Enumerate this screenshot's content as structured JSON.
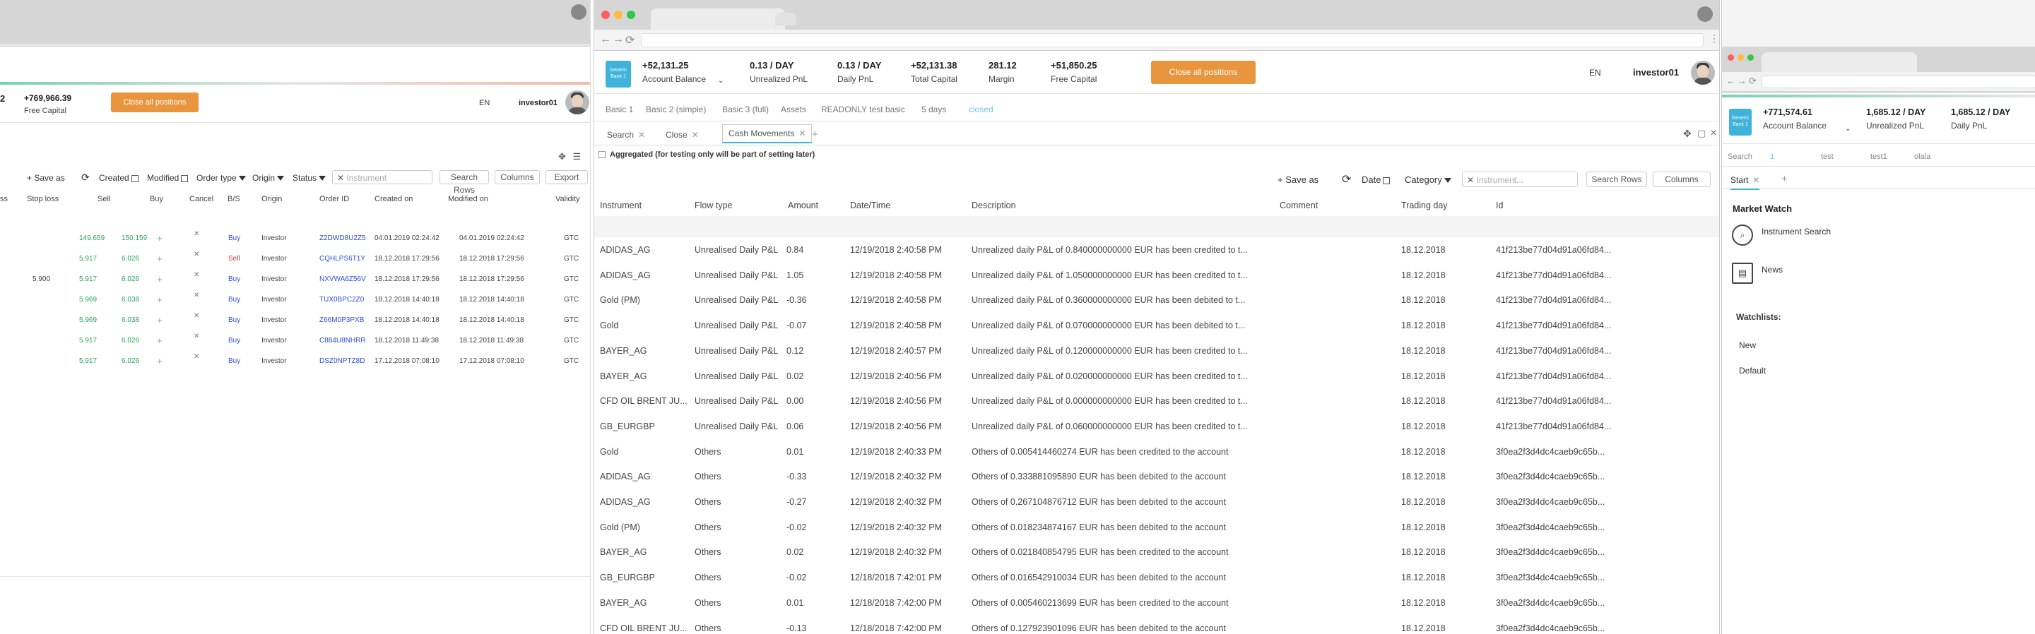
{
  "left_window": {
    "header": {
      "capital_partial": "2",
      "free_capital_value": "+769,966.39",
      "free_capital_label": "Free Capital",
      "close_all_label": "Close all positions",
      "lang": "EN",
      "user": "investor01"
    },
    "toolbar": {
      "save_as": "+ Save as",
      "created": "Created",
      "modified": "Modified",
      "order_type": "Order type",
      "origin": "Origin",
      "status": "Status",
      "search_placeholder": "Instrument",
      "search_rows": "Search Rows",
      "columns": "Columns",
      "export": "Export"
    },
    "columns": [
      "ss",
      "Stop loss",
      "Sell",
      "Buy",
      "Cancel",
      "B/S",
      "Origin",
      "Order ID",
      "Created on",
      "Modified on",
      "Validity"
    ],
    "rows": [
      {
        "stop": "",
        "sell": "149.659",
        "buy": "150.159",
        "bs": "Buy",
        "origin": "Investor",
        "order_id": "Z2DWD8U2Z5",
        "created": "04.01.2019 02:24:42",
        "modified": "04.01.2019 02:24:42",
        "validity": "GTC"
      },
      {
        "stop": "",
        "sell": "5.917",
        "buy": "6.026",
        "bs": "Sell",
        "origin": "Investor",
        "order_id": "CQHLPS6T1Y",
        "created": "18.12.2018 17:29:56",
        "modified": "18.12.2018 17:29:56",
        "validity": "GTC"
      },
      {
        "stop": "5.900",
        "sell": "5.917",
        "buy": "6.026",
        "bs": "Buy",
        "origin": "Investor",
        "order_id": "NXVWA6Z56V",
        "created": "18.12.2018 17:29:56",
        "modified": "18.12.2018 17:29:56",
        "validity": "GTC"
      },
      {
        "stop": "",
        "sell": "5.969",
        "buy": "6.038",
        "bs": "Buy",
        "origin": "Investor",
        "order_id": "TUX0BPC2Z0",
        "created": "18.12.2018 14:40:18",
        "modified": "18.12.2018 14:40:18",
        "validity": "GTC"
      },
      {
        "stop": "",
        "sell": "5.969",
        "buy": "6.038",
        "bs": "Buy",
        "origin": "Investor",
        "order_id": "Z66M0P3PXB",
        "created": "18.12.2018 14:40:18",
        "modified": "18.12.2018 14:40:18",
        "validity": "GTC"
      },
      {
        "stop": "",
        "sell": "5.917",
        "buy": "6.026",
        "bs": "Buy",
        "origin": "Investor",
        "order_id": "C884U8NHRR",
        "created": "18.12.2018 11:49:38",
        "modified": "18.12.2018 11:49:38",
        "validity": "GTC"
      },
      {
        "stop": "",
        "sell": "5.917",
        "buy": "6.026",
        "bs": "Buy",
        "origin": "Investor",
        "order_id": "DSZ0NPTZ8D",
        "created": "17.12.2018 07:08:10",
        "modified": "17.12.2018 07:08:10",
        "validity": "GTC"
      }
    ]
  },
  "center_window": {
    "header": {
      "logo_text": "Generic Bank 1",
      "stats": [
        {
          "value": "+52,131.25",
          "label": "Account Balance"
        },
        {
          "value": "0.13 / DAY",
          "label": "Unrealized PnL"
        },
        {
          "value": "0.13 / DAY",
          "label": "Daily PnL"
        },
        {
          "value": "+52,131.38",
          "label": "Total Capital"
        },
        {
          "value": "281.12",
          "label": "Margin"
        },
        {
          "value": "+51,850.25",
          "label": "Free Capital"
        }
      ],
      "close_all_label": "Close all positions",
      "lang": "EN",
      "user": "investor01"
    },
    "workspace_tabs": [
      "Basic 1",
      "Basic 2 (simple)",
      "Basic 3 (full)",
      "Assets",
      "READONLY test basic",
      "5 days",
      "closed"
    ],
    "panel_tabs": [
      "Search",
      "Close",
      "Cash Movements"
    ],
    "aggregated_label": "Aggregated (for testing only will be part of setting later)",
    "toolbar": {
      "save_as": "+ Save as",
      "date": "Date",
      "category": "Category",
      "search_placeholder": "Instrument...",
      "search_rows": "Search Rows",
      "columns": "Columns"
    },
    "columns": [
      "Instrument",
      "Flow type",
      "Amount",
      "Date/Time",
      "Description",
      "Comment",
      "Trading day",
      "Id"
    ],
    "rows": [
      {
        "instrument": "ADIDAS_AG",
        "flow": "Unrealised Daily P&L",
        "amount": "0.84",
        "datetime": "12/19/2018 2:40:58 PM",
        "desc": "Unrealized daily P&L of 0.840000000000 EUR has been credited to t...",
        "trading_day": "18.12.2018",
        "id": "41f213be77d04d91a06fd84..."
      },
      {
        "instrument": "ADIDAS_AG",
        "flow": "Unrealised Daily P&L",
        "amount": "1.05",
        "datetime": "12/19/2018 2:40:58 PM",
        "desc": "Unrealized daily P&L of 1.050000000000 EUR has been credited to t...",
        "trading_day": "18.12.2018",
        "id": "41f213be77d04d91a06fd84..."
      },
      {
        "instrument": "Gold (PM)",
        "flow": "Unrealised Daily P&L",
        "amount": "-0.36",
        "datetime": "12/19/2018 2:40:58 PM",
        "desc": "Unrealized daily P&L of 0.360000000000 EUR has been debited to t...",
        "trading_day": "18.12.2018",
        "id": "41f213be77d04d91a06fd84..."
      },
      {
        "instrument": "Gold",
        "flow": "Unrealised Daily P&L",
        "amount": "-0.07",
        "datetime": "12/19/2018 2:40:58 PM",
        "desc": "Unrealized daily P&L of 0.070000000000 EUR has been debited to t...",
        "trading_day": "18.12.2018",
        "id": "41f213be77d04d91a06fd84..."
      },
      {
        "instrument": "BAYER_AG",
        "flow": "Unrealised Daily P&L",
        "amount": "0.12",
        "datetime": "12/19/2018 2:40:57 PM",
        "desc": "Unrealized daily P&L of 0.120000000000 EUR has been credited to t...",
        "trading_day": "18.12.2018",
        "id": "41f213be77d04d91a06fd84..."
      },
      {
        "instrument": "BAYER_AG",
        "flow": "Unrealised Daily P&L",
        "amount": "0.02",
        "datetime": "12/19/2018 2:40:56 PM",
        "desc": "Unrealized daily P&L of 0.020000000000 EUR has been credited to t...",
        "trading_day": "18.12.2018",
        "id": "41f213be77d04d91a06fd84..."
      },
      {
        "instrument": "CFD OIL BRENT JU...",
        "flow": "Unrealised Daily P&L",
        "amount": "0.00",
        "datetime": "12/19/2018 2:40:56 PM",
        "desc": "Unrealized daily P&L of 0.000000000000 EUR has been credited to t...",
        "trading_day": "18.12.2018",
        "id": "41f213be77d04d91a06fd84..."
      },
      {
        "instrument": "GB_EURGBP",
        "flow": "Unrealised Daily P&L",
        "amount": "0.06",
        "datetime": "12/19/2018 2:40:56 PM",
        "desc": "Unrealized daily P&L of 0.060000000000 EUR has been credited to t...",
        "trading_day": "18.12.2018",
        "id": "41f213be77d04d91a06fd84..."
      },
      {
        "instrument": "Gold",
        "flow": "Others",
        "amount": "0.01",
        "datetime": "12/19/2018 2:40:33 PM",
        "desc": "Others of 0.005414460274 EUR has been credited to the account",
        "trading_day": "18.12.2018",
        "id": "3f0ea2f3d4dc4caeb9c65b..."
      },
      {
        "instrument": "ADIDAS_AG",
        "flow": "Others",
        "amount": "-0.33",
        "datetime": "12/19/2018 2:40:32 PM",
        "desc": "Others of 0.333881095890 EUR has been debited to the account",
        "trading_day": "18.12.2018",
        "id": "3f0ea2f3d4dc4caeb9c65b..."
      },
      {
        "instrument": "ADIDAS_AG",
        "flow": "Others",
        "amount": "-0.27",
        "datetime": "12/19/2018 2:40:32 PM",
        "desc": "Others of 0.267104876712 EUR has been debited to the account",
        "trading_day": "18.12.2018",
        "id": "3f0ea2f3d4dc4caeb9c65b..."
      },
      {
        "instrument": "Gold (PM)",
        "flow": "Others",
        "amount": "-0.02",
        "datetime": "12/19/2018 2:40:32 PM",
        "desc": "Others of 0.018234874167 EUR has been debited to the account",
        "trading_day": "18.12.2018",
        "id": "3f0ea2f3d4dc4caeb9c65b..."
      },
      {
        "instrument": "BAYER_AG",
        "flow": "Others",
        "amount": "0.02",
        "datetime": "12/19/2018 2:40:32 PM",
        "desc": "Others of 0.021840854795 EUR has been credited to the account",
        "trading_day": "18.12.2018",
        "id": "3f0ea2f3d4dc4caeb9c65b..."
      },
      {
        "instrument": "GB_EURGBP",
        "flow": "Others",
        "amount": "-0.02",
        "datetime": "12/18/2018 7:42:01 PM",
        "desc": "Others of 0.016542910034 EUR has been debited to the account",
        "trading_day": "18.12.2018",
        "id": "3f0ea2f3d4dc4caeb9c65b..."
      },
      {
        "instrument": "BAYER_AG",
        "flow": "Others",
        "amount": "0.01",
        "datetime": "12/18/2018 7:42:00 PM",
        "desc": "Others of 0.005460213699 EUR has been credited to the account",
        "trading_day": "18.12.2018",
        "id": "3f0ea2f3d4dc4caeb9c65b..."
      },
      {
        "instrument": "CFD OIL BRENT JU...",
        "flow": "Others",
        "amount": "-0.13",
        "datetime": "12/18/2018 7:42:00 PM",
        "desc": "Others of 0.127923901096 EUR has been debited to the account",
        "trading_day": "18.12.2018",
        "id": "3f0ea2f3d4dc4caeb9c65b..."
      }
    ]
  },
  "right_window": {
    "header": {
      "logo_text": "Generic Bank 1",
      "stats": [
        {
          "value": "+771,574.61",
          "label": "Account Balance"
        },
        {
          "value": "1,685.12 / DAY",
          "label": "Unrealized PnL"
        },
        {
          "value": "1,685.12 / DAY",
          "label": "Daily PnL"
        }
      ]
    },
    "workspace_tabs": [
      "Search",
      "1",
      "test",
      "test1",
      "olala"
    ],
    "panel_tab": "Start",
    "market_watch_title": "Market Watch",
    "instrument_search": "Instrument Search",
    "news": "News",
    "watchlists_title": "Watchlists:",
    "watchlists": [
      "New",
      "Default"
    ]
  },
  "colors": {
    "accent_orange": "#e8953d",
    "buy_blue": "#2b4fd8",
    "sell_red": "#d63333",
    "price_green": "#2ea35f",
    "logo_cyan": "#3fb3d9"
  }
}
